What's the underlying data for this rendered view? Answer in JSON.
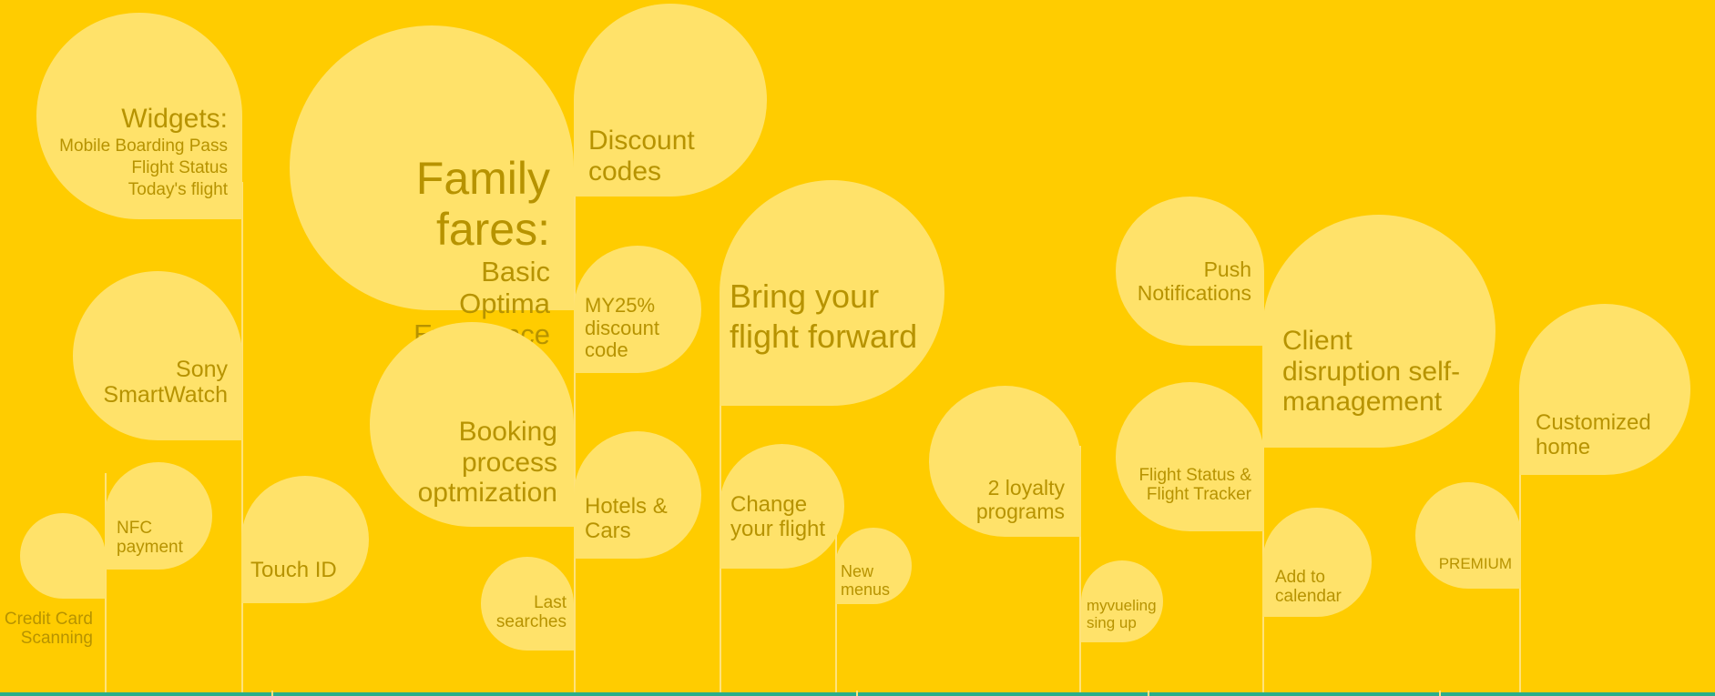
{
  "theme": {
    "background": "#FFCC00",
    "bubble": "#FFE26A",
    "text": "#B79300",
    "stem": "#FFE27A",
    "baseline": "#2AAE8A"
  },
  "bubbles": {
    "widgets": {
      "title": "Widgets:",
      "items": [
        "Mobile Boarding Pass",
        "Flight Status",
        "Today's flight"
      ]
    },
    "family_fares": {
      "title": "Family fares:",
      "items": [
        "Basic",
        "Optima",
        "Excellence"
      ]
    },
    "discount_codes": {
      "lines": [
        "Discount",
        "codes"
      ]
    },
    "my25": {
      "lines": [
        "MY25%",
        "discount",
        "code"
      ]
    },
    "sony": {
      "lines": [
        "Sony",
        "SmartWatch"
      ]
    },
    "booking": {
      "lines": [
        "Booking",
        "process",
        "optmization"
      ]
    },
    "hotels": {
      "lines": [
        "Hotels &",
        "Cars"
      ]
    },
    "nfc": {
      "lines": [
        "NFC",
        "payment"
      ]
    },
    "touch_id": {
      "lines": [
        "Touch ID"
      ]
    },
    "credit_card": {
      "lines": [
        "Credit Card",
        "Scanning"
      ]
    },
    "last_searches": {
      "lines": [
        "Last",
        "searches"
      ]
    },
    "bring_forward": {
      "lines": [
        "Bring your",
        "flight forward"
      ]
    },
    "change_flight": {
      "lines": [
        "Change",
        "your flight"
      ]
    },
    "new_menus": {
      "lines": [
        "New",
        "menus"
      ]
    },
    "loyalty": {
      "lines": [
        "2 loyalty",
        "programs"
      ]
    },
    "myvueling": {
      "lines": [
        "myvueling",
        "sing up"
      ]
    },
    "push": {
      "lines": [
        "Push",
        "Notifications"
      ]
    },
    "flight_status": {
      "lines": [
        "Flight Status &",
        "Flight Tracker"
      ]
    },
    "client_disruption": {
      "lines": [
        "Client",
        "disruption self-",
        "management"
      ]
    },
    "add_calendar": {
      "lines": [
        "Add to",
        "calendar"
      ]
    },
    "premium": {
      "lines": [
        "PREMIUM"
      ]
    },
    "customized_home": {
      "lines": [
        "Customized",
        "home"
      ]
    }
  }
}
